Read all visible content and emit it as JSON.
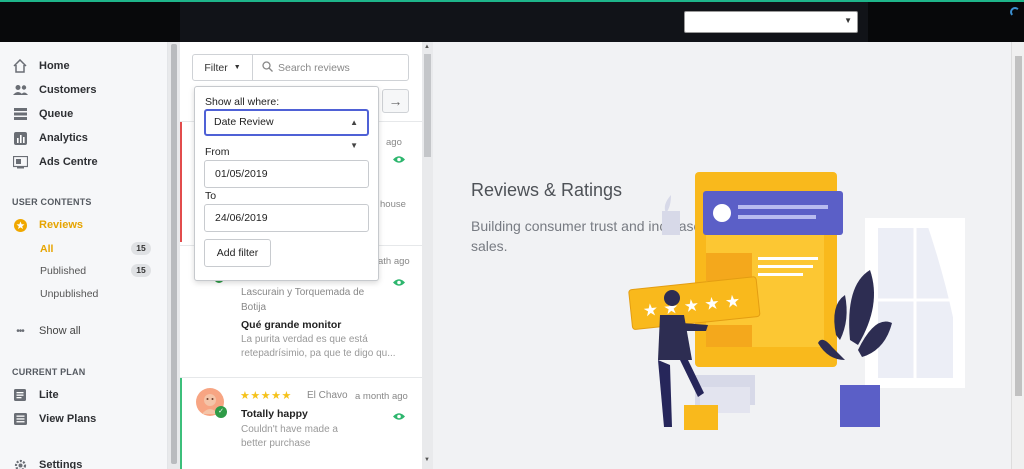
{
  "sidebar": {
    "nav": [
      {
        "icon": "home-icon",
        "label": "Home"
      },
      {
        "icon": "users-icon",
        "label": "Customers"
      },
      {
        "icon": "queue-icon",
        "label": "Queue"
      },
      {
        "icon": "analytics-icon",
        "label": "Analytics"
      },
      {
        "icon": "ads-icon",
        "label": "Ads Centre"
      }
    ],
    "user_contents_label": "USER CONTENTS",
    "reviews_label": "Reviews",
    "sub": [
      {
        "label": "All",
        "count": "15"
      },
      {
        "label": "Published",
        "count": "15"
      },
      {
        "label": "Unpublished"
      }
    ],
    "show_all": "Show all",
    "current_plan_label": "CURRENT PLAN",
    "plan": "Lite",
    "view_plans": "View Plans",
    "settings": "Settings"
  },
  "toolbar": {
    "filter_label": "Filter",
    "search_placeholder": "Search reviews"
  },
  "filter_dropdown": {
    "show_all_where": "Show all where:",
    "field": "Date Review",
    "from_label": "From",
    "from_value": "01/05/2019",
    "to_label": "To",
    "to_value": "24/06/2019",
    "add_button": "Add filter"
  },
  "reviews": {
    "peek1_time": "ago",
    "peek1_text": "house",
    "peek2_time": "ath ago",
    "review2": {
      "author": "Lascurain y Torquemada de Botija",
      "title": "Qué grande monitor",
      "body": "La purita verdad es que está retepadrísimio, pa que te digo qu..."
    },
    "review3": {
      "stars": "★★★★★",
      "author": "El Chavo",
      "time": "a month ago",
      "title": "Totally happy",
      "body": "Couldn't have made a better purchase"
    }
  },
  "main": {
    "title": "Reviews & Ratings",
    "subtitle": "Building consumer trust and increase sales."
  },
  "colors": {
    "accent": "#e6a400",
    "primary_focus": "#4f61d6",
    "topbar": "#111318",
    "topbar_line": "#1eb58a",
    "illustration_yellow": "#f9b91c",
    "illustration_purple": "#5b5fc7"
  }
}
